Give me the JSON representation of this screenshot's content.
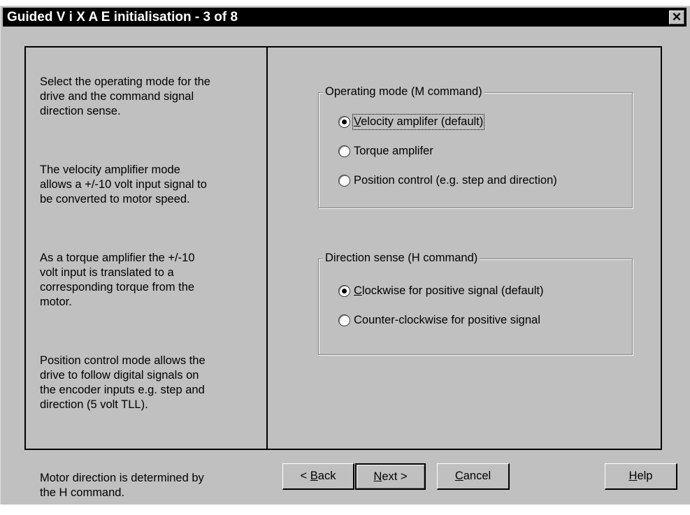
{
  "window": {
    "title": "Guided V i X A E initialisation - 3 of 8",
    "close_glyph": "✕"
  },
  "help": {
    "p1": "Select the operating mode for the\ndrive and the command signal\ndirection sense.",
    "p2": "The velocity amplifier mode\nallows a +/-10 volt input signal to\nbe converted to motor speed.",
    "p3": "As a torque amplifier the +/-10\nvolt input is translated to a\ncorresponding torque from the\nmotor.",
    "p4": "Position control mode allows the\ndrive to follow digital signals on\nthe encoder inputs e.g. step and\ndirection (5 volt TLL).",
    "p5": "Motor direction is determined by\nthe H command."
  },
  "operating_mode": {
    "legend": "Operating mode (M command)",
    "selected": "velocity",
    "options": [
      {
        "id": "velocity",
        "mnemonic": "V",
        "rest": "elocity amplifer (default)"
      },
      {
        "id": "torque",
        "label": "Torque amplifer"
      },
      {
        "id": "position",
        "label": "Position control (e.g. step and direction)"
      }
    ]
  },
  "direction_sense": {
    "legend": "Direction sense (H command)",
    "selected": "clockwise",
    "options": [
      {
        "id": "clockwise",
        "mnemonic": "C",
        "rest": "lockwise for positive signal (default)"
      },
      {
        "id": "counter",
        "label": "Counter-clockwise for positive signal"
      }
    ]
  },
  "buttons": {
    "back": {
      "pre": "< ",
      "mnemonic": "B",
      "rest": "ack"
    },
    "next": {
      "mnemonic": "N",
      "rest": "ext >"
    },
    "cancel": {
      "mnemonic": "C",
      "rest": "ancel"
    },
    "help": {
      "mnemonic": "H",
      "rest": "elp"
    }
  }
}
